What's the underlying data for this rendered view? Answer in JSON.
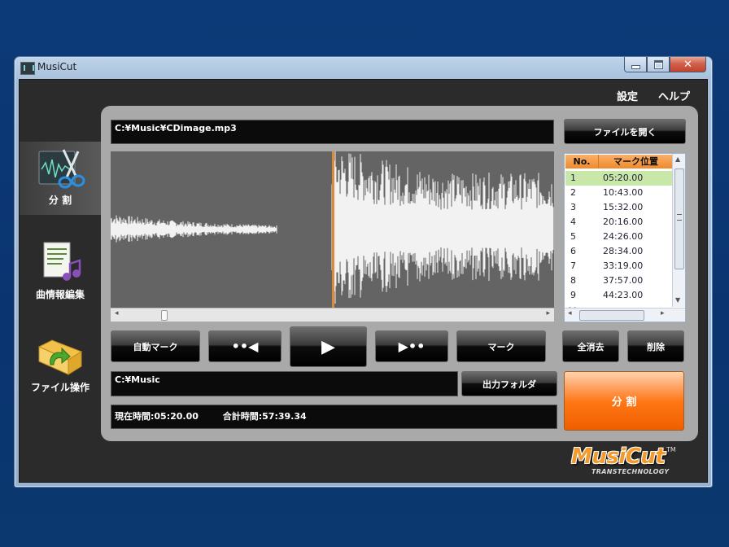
{
  "window": {
    "title": "MusiCut"
  },
  "menu": {
    "settings": "設定",
    "help": "ヘルプ"
  },
  "sidebar": {
    "items": [
      {
        "label": "分 割",
        "icon": "scissors-waveform-icon",
        "active": true
      },
      {
        "label": "曲情報編集",
        "icon": "music-document-icon",
        "active": false
      },
      {
        "label": "ファイル操作",
        "icon": "folder-arrow-icon",
        "active": false
      }
    ]
  },
  "file": {
    "path": "C:¥Music¥CDimage.mp3",
    "open_button": "ファイルを開く"
  },
  "marks": {
    "headers": [
      "No.",
      "マーク位置"
    ],
    "rows": [
      {
        "no": "1",
        "pos": "05:20.00",
        "selected": true
      },
      {
        "no": "2",
        "pos": "10:43.00"
      },
      {
        "no": "3",
        "pos": "15:32.00"
      },
      {
        "no": "4",
        "pos": "20:16.00"
      },
      {
        "no": "5",
        "pos": "24:26.00"
      },
      {
        "no": "6",
        "pos": "28:34.00"
      },
      {
        "no": "7",
        "pos": "33:19.00"
      },
      {
        "no": "8",
        "pos": "37:57.00"
      },
      {
        "no": "9",
        "pos": "44:23.00"
      }
    ]
  },
  "controls": {
    "auto_mark": "自動マーク",
    "mark": "マーク",
    "clear_all": "全消去",
    "delete": "削除"
  },
  "output": {
    "folder": "C:¥Music",
    "folder_button": "出力フォルダ"
  },
  "status": {
    "current": "現在時間:05:20.00",
    "total": "合計時間:57:39.34"
  },
  "split_button": "分 割",
  "logo": {
    "text": "MusiCut",
    "tm": "TM",
    "sub": "TRANSTECHNOLOGY"
  },
  "colors": {
    "accent": "#ff7a1a",
    "selected_row": "#c8e7a9",
    "playhead": "#d98a3a"
  }
}
